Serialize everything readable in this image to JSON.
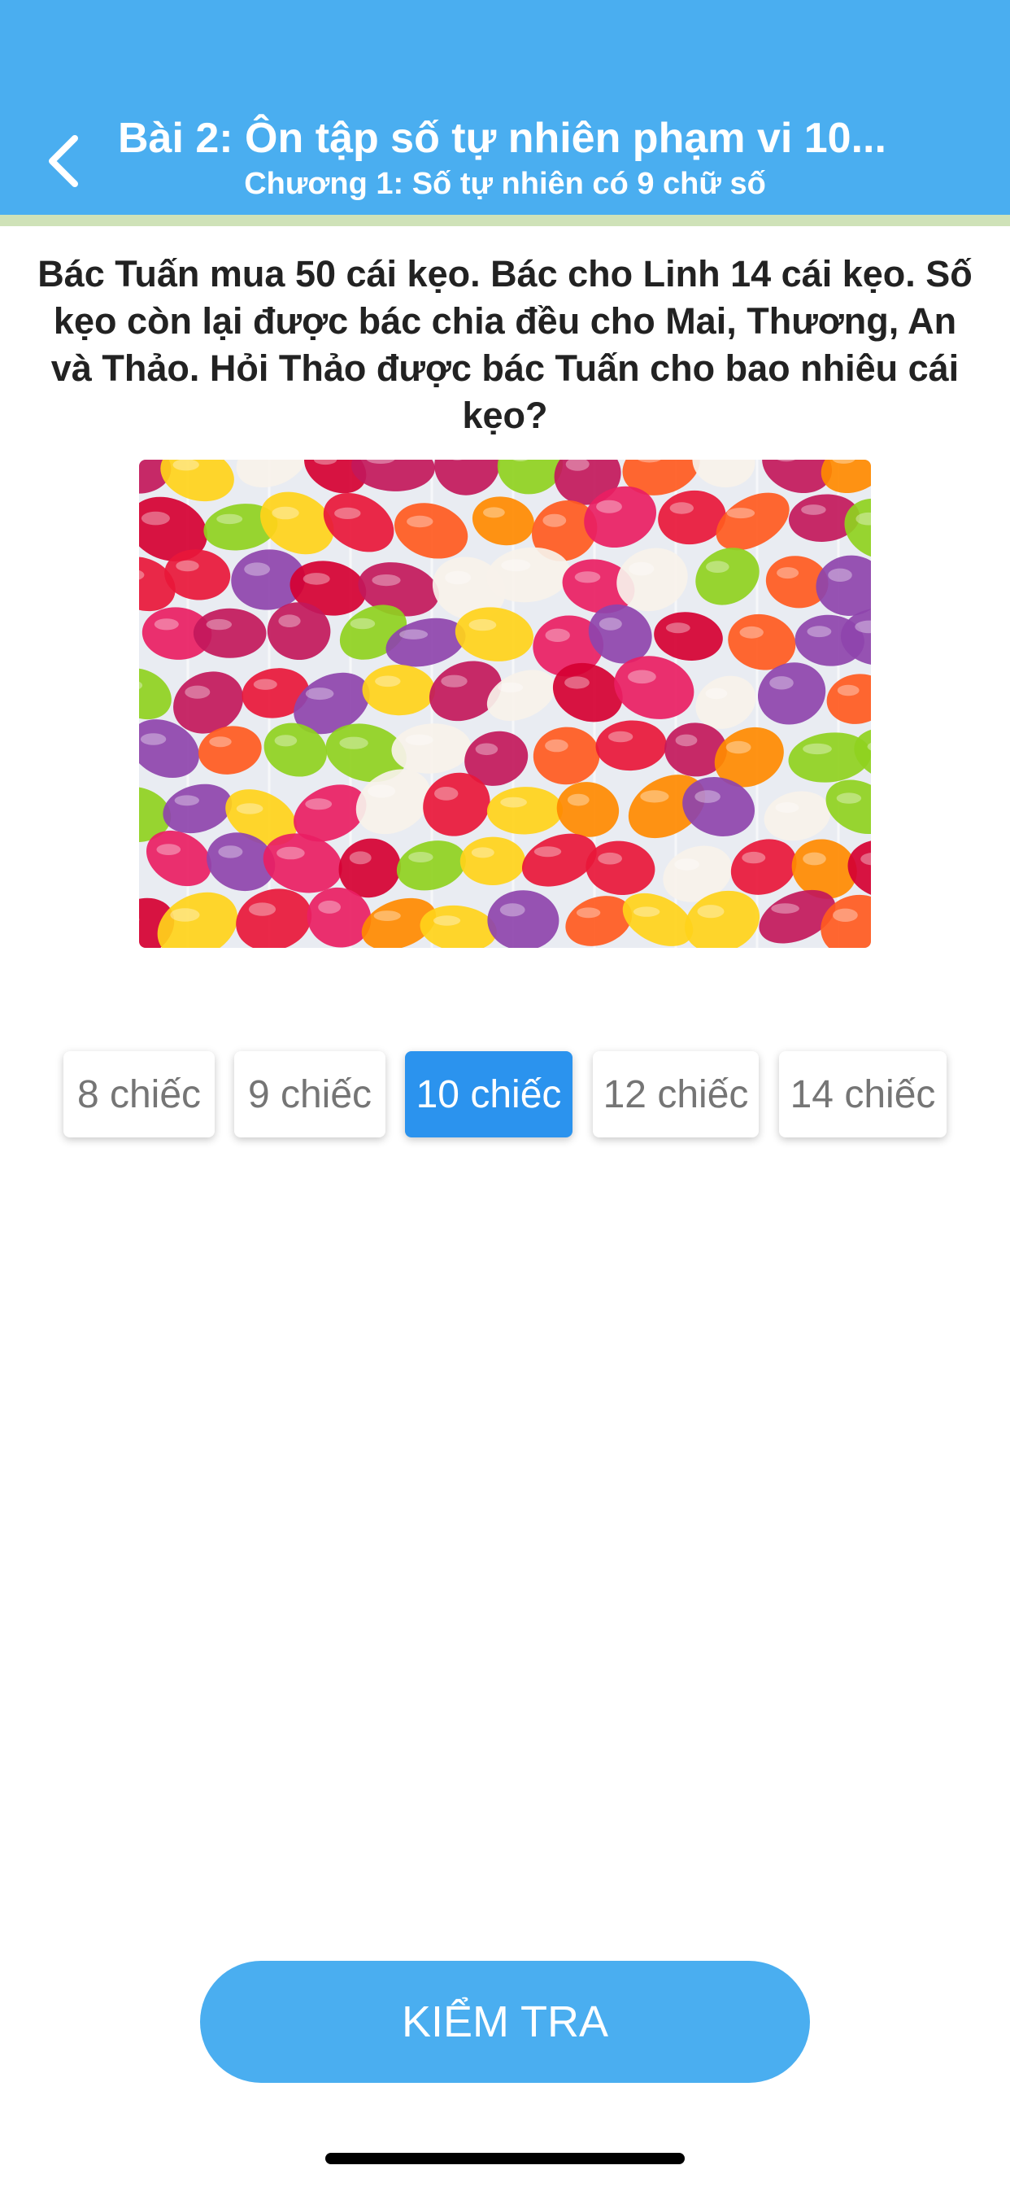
{
  "header": {
    "title": "Bài 2: Ôn tập số tự nhiên phạm vi 10...",
    "subtitle": "Chương 1: Số tự nhiên có 9 chữ số",
    "color": "#4aaef0",
    "back_icon": "chevron-left-icon"
  },
  "question": {
    "text": "Bác Tuấn mua 50 cái kẹo. Bác cho Linh 14 cái kẹo. Số kẹo còn lại được bác chia đều cho Mai, Thương, An và Thảo. Hỏi Thảo được bác Tuấn cho bao nhiêu cái kẹo?"
  },
  "options": [
    {
      "label": "8 chiếc",
      "selected": false
    },
    {
      "label": "9 chiếc",
      "selected": false
    },
    {
      "label": "10 chiếc",
      "selected": true
    },
    {
      "label": "12 chiếc",
      "selected": false
    },
    {
      "label": "14 chiếc",
      "selected": false
    }
  ],
  "check_button": {
    "label": "KIỂM TRA"
  },
  "colors": {
    "accent": "#4aaef0",
    "selected": "#2b93ee"
  }
}
